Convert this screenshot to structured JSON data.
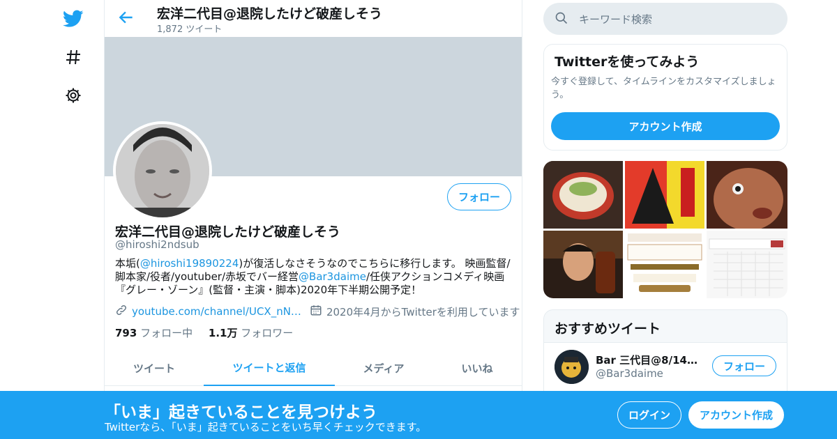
{
  "nav": {
    "icons": [
      "twitter-bird-icon",
      "hashtag-icon",
      "settings-gear-icon"
    ]
  },
  "header": {
    "title": "宏洋二代目@退院したけど破産しそう",
    "tweet_count": "1,872 ツイート"
  },
  "profile": {
    "follow_label": "フォロー",
    "name": "宏洋二代目@退院したけど破産しそう",
    "handle": "@hiroshi2ndsub",
    "bio": {
      "p1": "本垢(",
      "m1": "@hiroshi19890224",
      "p2": ")が復活しなさそうなのでこちらに移行します。 映画監督/脚本家/役者/youtuber/赤坂でバー経営",
      "m2": "@Bar3daime",
      "p3": "/任侠アクションコメディ映画『グレー・ゾーン』(監督・主演・脚本)2020年下半期公開予定！"
    },
    "link": "youtube.com/channel/UCX_nN…",
    "joined": "2020年4月からTwitterを利用しています",
    "following_count": "793",
    "following_label": "フォロー中",
    "followers_count": "1.1万",
    "followers_label": "フォロワー"
  },
  "tabs": [
    {
      "label": "ツイート"
    },
    {
      "label": "ツイートと返信"
    },
    {
      "label": "メディア"
    },
    {
      "label": "いいね"
    }
  ],
  "search": {
    "placeholder": "キーワード検索"
  },
  "signup_card": {
    "title": "Twitterを使ってみよう",
    "text": "今すぐ登録して、タイムラインをカスタマイズしましょう。",
    "button": "アカウント作成"
  },
  "recommended": {
    "title": "おすすめツイート",
    "user_name": "Bar 三代目@8/14ビ…",
    "user_handle": "@Bar3daime",
    "follow_label": "フォロー"
  },
  "bottom_bar": {
    "title": "「いま」起きていることを見つけよう",
    "subtitle": "Twitterなら、「いま」起きていることをいち早くチェックできます。",
    "login": "ログイン",
    "signup": "アカウント作成"
  },
  "colors": {
    "accent": "#1da1f2",
    "banner": "#ccd6dd",
    "muted": "#657786"
  }
}
